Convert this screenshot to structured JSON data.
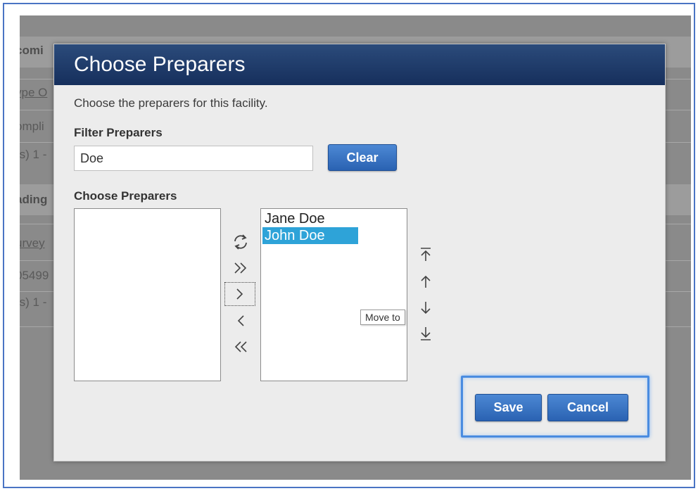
{
  "background": {
    "rows": [
      {
        "text": "comi",
        "style": "bold"
      },
      {
        "text": "ype O",
        "style": "link"
      },
      {
        "text": "ompli",
        "style": "plain"
      },
      {
        "text": "(s) 1 -",
        "style": "plain"
      },
      {
        "text": "ading",
        "style": "bold"
      },
      {
        "text": "urvey",
        "style": "link"
      },
      {
        "text": "05499",
        "style": "plain"
      },
      {
        "text": "(s) 1 -",
        "style": "plain"
      }
    ]
  },
  "dialog": {
    "title": "Choose Preparers",
    "description": "Choose the preparers for this facility.",
    "filter_label": "Filter Preparers",
    "filter_value": "Doe",
    "clear_label": "Clear",
    "choose_label": "Choose Preparers",
    "available": [],
    "selected": [
      {
        "label": "Jane Doe",
        "selected": false
      },
      {
        "label": "John Doe",
        "selected": true
      }
    ],
    "tooltip": "Move to",
    "save_label": "Save",
    "cancel_label": "Cancel"
  },
  "icons": {
    "refresh": "refresh-icon",
    "move_all_right": "double-chevron-right-icon",
    "move_right": "chevron-right-icon",
    "move_left": "chevron-left-icon",
    "move_all_left": "double-chevron-left-icon",
    "move_top": "arrow-to-top-icon",
    "move_up": "arrow-up-icon",
    "move_down": "arrow-down-icon",
    "move_bottom": "arrow-to-bottom-icon"
  },
  "colors": {
    "header": "#1f3a6b",
    "button": "#2f6bbf",
    "selection": "#2ea3d8",
    "highlight": "#4a8ce0"
  }
}
